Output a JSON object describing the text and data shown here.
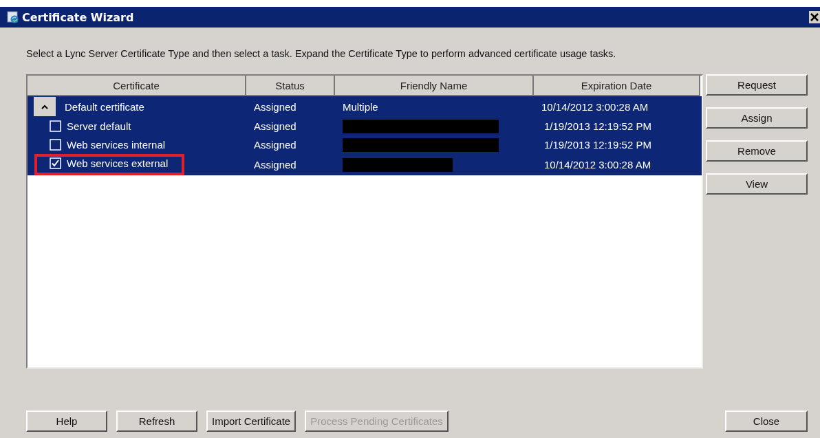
{
  "window": {
    "title": "Certificate Wizard"
  },
  "instructions": "Select a Lync Server Certificate Type and then select a task. Expand the Certificate Type to perform advanced certificate usage tasks.",
  "table": {
    "columns": [
      "Certificate",
      "Status",
      "Friendly Name",
      "Expiration Date"
    ],
    "rows": [
      {
        "certificate": "Default certificate",
        "status": "Assigned",
        "friendly_name": "Multiple",
        "expiration_date": "10/14/2012 3:00:28 AM",
        "expanded": true,
        "selected": true,
        "children": [
          {
            "certificate": "Server default",
            "status": "Assigned",
            "friendly_name_redacted": true,
            "expiration_date": "1/19/2013 12:19:52 PM",
            "checked": false,
            "selected": true,
            "highlighted": false
          },
          {
            "certificate": "Web services internal",
            "status": "Assigned",
            "friendly_name_redacted": true,
            "expiration_date": "1/19/2013 12:19:52 PM",
            "checked": false,
            "selected": true,
            "highlighted": false
          },
          {
            "certificate": "Web services external",
            "status": "Assigned",
            "friendly_name_redacted": true,
            "expiration_date": "10/14/2012 3:00:28 AM",
            "checked": true,
            "selected": true,
            "highlighted": true
          }
        ]
      }
    ]
  },
  "side_buttons": [
    {
      "label": "Request",
      "disabled": false
    },
    {
      "label": "Assign",
      "disabled": false
    },
    {
      "label": "Remove",
      "disabled": false
    },
    {
      "label": "View",
      "disabled": false
    }
  ],
  "bottom_buttons": [
    {
      "label": "Help",
      "disabled": false
    },
    {
      "label": "Refresh",
      "disabled": false
    },
    {
      "label": "Import Certificate",
      "disabled": false
    },
    {
      "label": "Process Pending Certificates",
      "disabled": true
    }
  ],
  "close_button": {
    "label": "Close",
    "disabled": false
  }
}
